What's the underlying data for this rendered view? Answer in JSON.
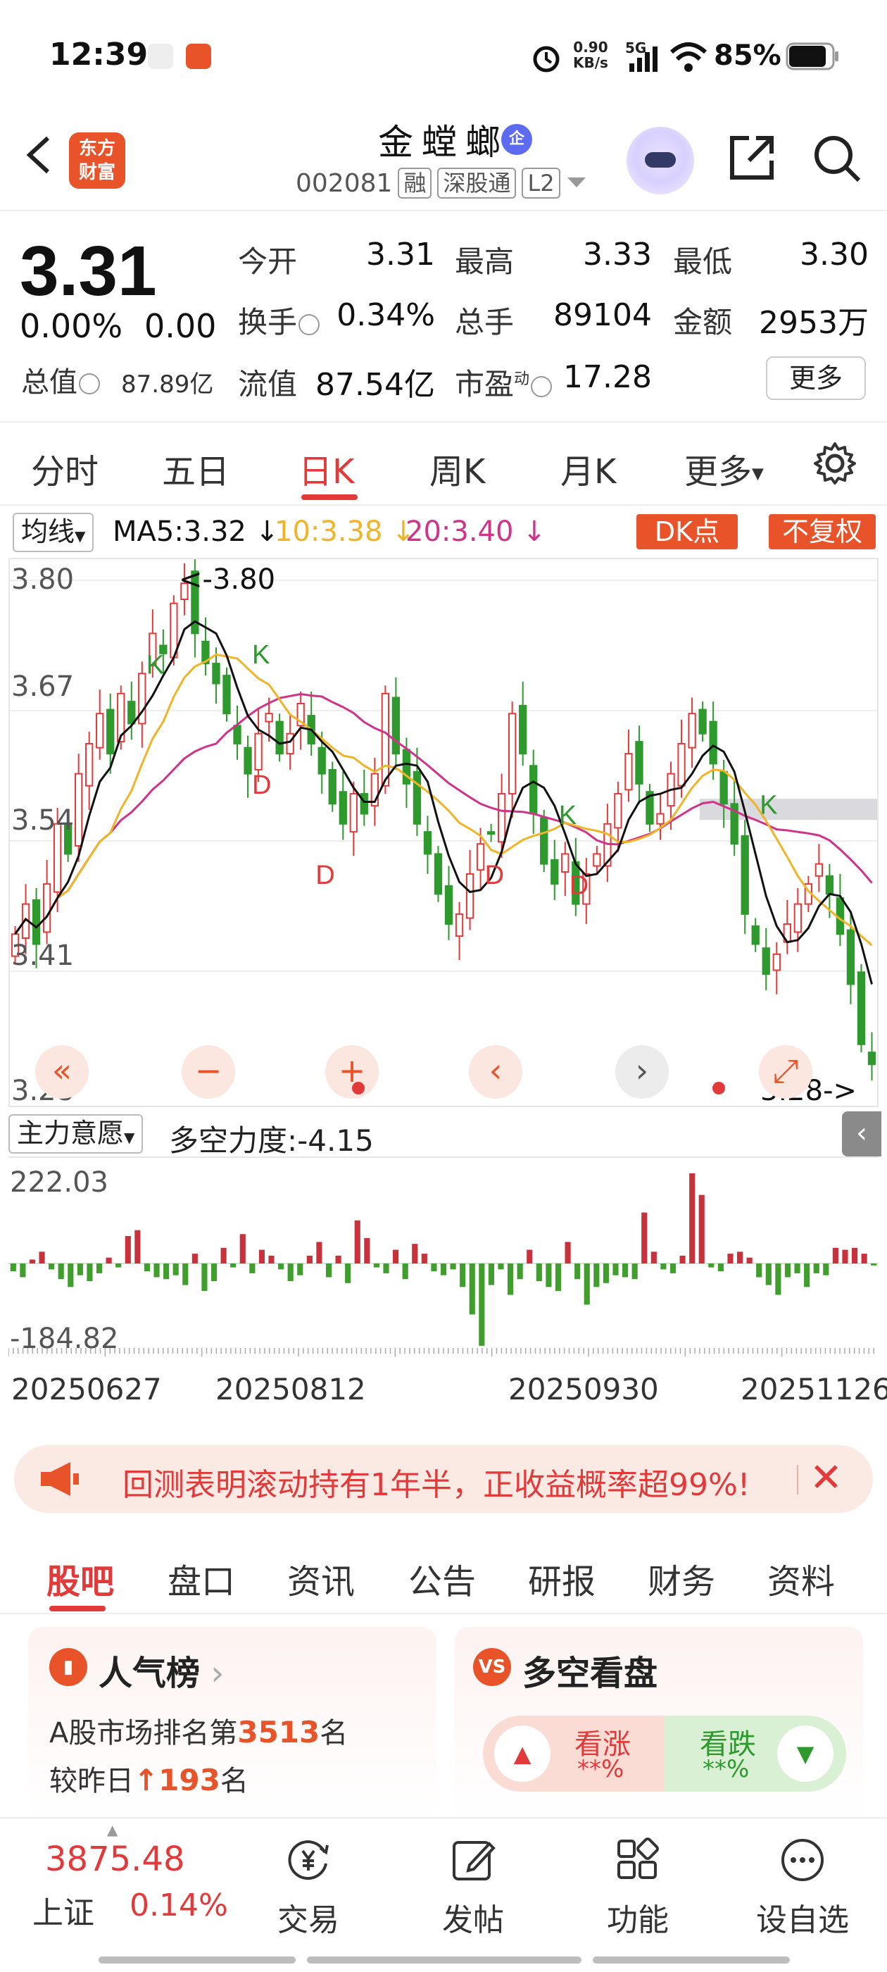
{
  "status_bar": {
    "time": "12:39",
    "net_speed_top": "0.90",
    "net_speed_bottom": "KB/s",
    "network": "5G",
    "battery": "85%"
  },
  "header": {
    "stock_name": "金螳螂",
    "badge": "企",
    "logo_line1": "东方",
    "logo_line2": "财富",
    "code": "002081",
    "tags": [
      "融",
      "深股通",
      "L2"
    ]
  },
  "quote": {
    "price": "3.31",
    "change_pct": "0.00%",
    "change_val": "0.00",
    "total_value_label": "总值",
    "total_value": "87.89亿",
    "open_label": "今开",
    "open": "3.31",
    "high_label": "最高",
    "high": "3.33",
    "low_label": "最低",
    "low": "3.30",
    "turnover_label": "换手",
    "turnover": "0.34%",
    "volume_label": "总手",
    "volume": "89104",
    "amount_label": "金额",
    "amount": "2953万",
    "float_value_label": "流值",
    "float_value": "87.54亿",
    "pe_label": "市盈",
    "pe_sup": "动",
    "pe": "17.28",
    "more": "更多"
  },
  "period_tabs": [
    "分时",
    "五日",
    "日K",
    "周K",
    "月K",
    "更多"
  ],
  "active_period": "日K",
  "ma": {
    "selector": "均线",
    "ma5": "MA5:3.32 ↓",
    "ma10": "10:3.38 ↓",
    "ma20": "20:3.40 ↓",
    "dk_button": "DK点",
    "fq_button": "不复权",
    "colors": {
      "ma5": "#111111",
      "ma10": "#f0b429",
      "ma20": "#d0338a"
    }
  },
  "chart_data": {
    "type": "candlestick",
    "y_ticks": [
      "3.80",
      "3.67",
      "3.54",
      "3.41",
      "3.28"
    ],
    "ylim": [
      3.28,
      3.8
    ],
    "max_label": "<-3.80",
    "min_label": "3.28->",
    "markers": [
      "K",
      "K",
      "D",
      "D",
      "D",
      "K",
      "D",
      "K"
    ],
    "closes": [
      3.44,
      3.47,
      3.43,
      3.49,
      3.55,
      3.52,
      3.6,
      3.63,
      3.66,
      3.62,
      3.68,
      3.65,
      3.7,
      3.74,
      3.72,
      3.77,
      3.79,
      3.74,
      3.71,
      3.69,
      3.66,
      3.63,
      3.6,
      3.64,
      3.66,
      3.62,
      3.64,
      3.67,
      3.63,
      3.6,
      3.57,
      3.55,
      3.58,
      3.56,
      3.6,
      3.68,
      3.62,
      3.59,
      3.55,
      3.52,
      3.48,
      3.45,
      3.46,
      3.5,
      3.53,
      3.54,
      3.58,
      3.66,
      3.62,
      3.56,
      3.51,
      3.49,
      3.52,
      3.47,
      3.5,
      3.52,
      3.55,
      3.58,
      3.62,
      3.59,
      3.55,
      3.56,
      3.6,
      3.63,
      3.66,
      3.64,
      3.61,
      3.57,
      3.53,
      3.46,
      3.43,
      3.4,
      3.42,
      3.45,
      3.47,
      3.49,
      3.51,
      3.48,
      3.44,
      3.39,
      3.33,
      3.31
    ]
  },
  "indicator": {
    "selector": "主力意愿",
    "text": "多空力度:-4.15",
    "ymax": "222.03",
    "ymin": "-184.82",
    "values": [
      -20,
      -35,
      10,
      30,
      -15,
      -40,
      -60,
      -30,
      -45,
      -25,
      15,
      -10,
      70,
      85,
      -20,
      -35,
      -40,
      -30,
      -55,
      25,
      -70,
      -45,
      40,
      -10,
      75,
      -25,
      35,
      20,
      -15,
      -45,
      -30,
      20,
      55,
      -35,
      20,
      -50,
      110,
      65,
      -10,
      -25,
      35,
      -40,
      50,
      25,
      -20,
      -30,
      -15,
      -60,
      -130,
      -210,
      -55,
      -15,
      -80,
      -40,
      35,
      -45,
      -60,
      -70,
      55,
      -40,
      -105,
      -60,
      -50,
      -30,
      -35,
      -40,
      130,
      30,
      -15,
      -25,
      20,
      230,
      175,
      -10,
      -20,
      25,
      30,
      15,
      -35,
      -55,
      -80,
      -35,
      -25,
      -60,
      -25,
      -30,
      40,
      35,
      40,
      25,
      -5
    ]
  },
  "dates": [
    "20250627",
    "20250812",
    "20250930",
    "20251126"
  ],
  "banner": {
    "text": "回测表明滚动持有1年半，正收益概率超99%!"
  },
  "bottom_tabs": [
    "股吧",
    "盘口",
    "资讯",
    "公告",
    "研报",
    "财务",
    "资料"
  ],
  "active_bottom_tab": "股吧",
  "popularity": {
    "title": "人气榜",
    "line1_prefix": "A股市场排名第",
    "rank": "3513",
    "line1_suffix": "名",
    "line2_prefix": "较昨日",
    "change": "193",
    "line2_suffix": "名"
  },
  "sentiment": {
    "icon": "VS",
    "title": "多空看盘",
    "up_label": "看涨",
    "up_value": "**%",
    "down_label": "看跌",
    "down_value": "**%"
  },
  "footer": {
    "index_value": "3875.48",
    "index_name": "上证",
    "index_change": "0.14%",
    "items": [
      "交易",
      "发帖",
      "功能",
      "设自选"
    ]
  }
}
